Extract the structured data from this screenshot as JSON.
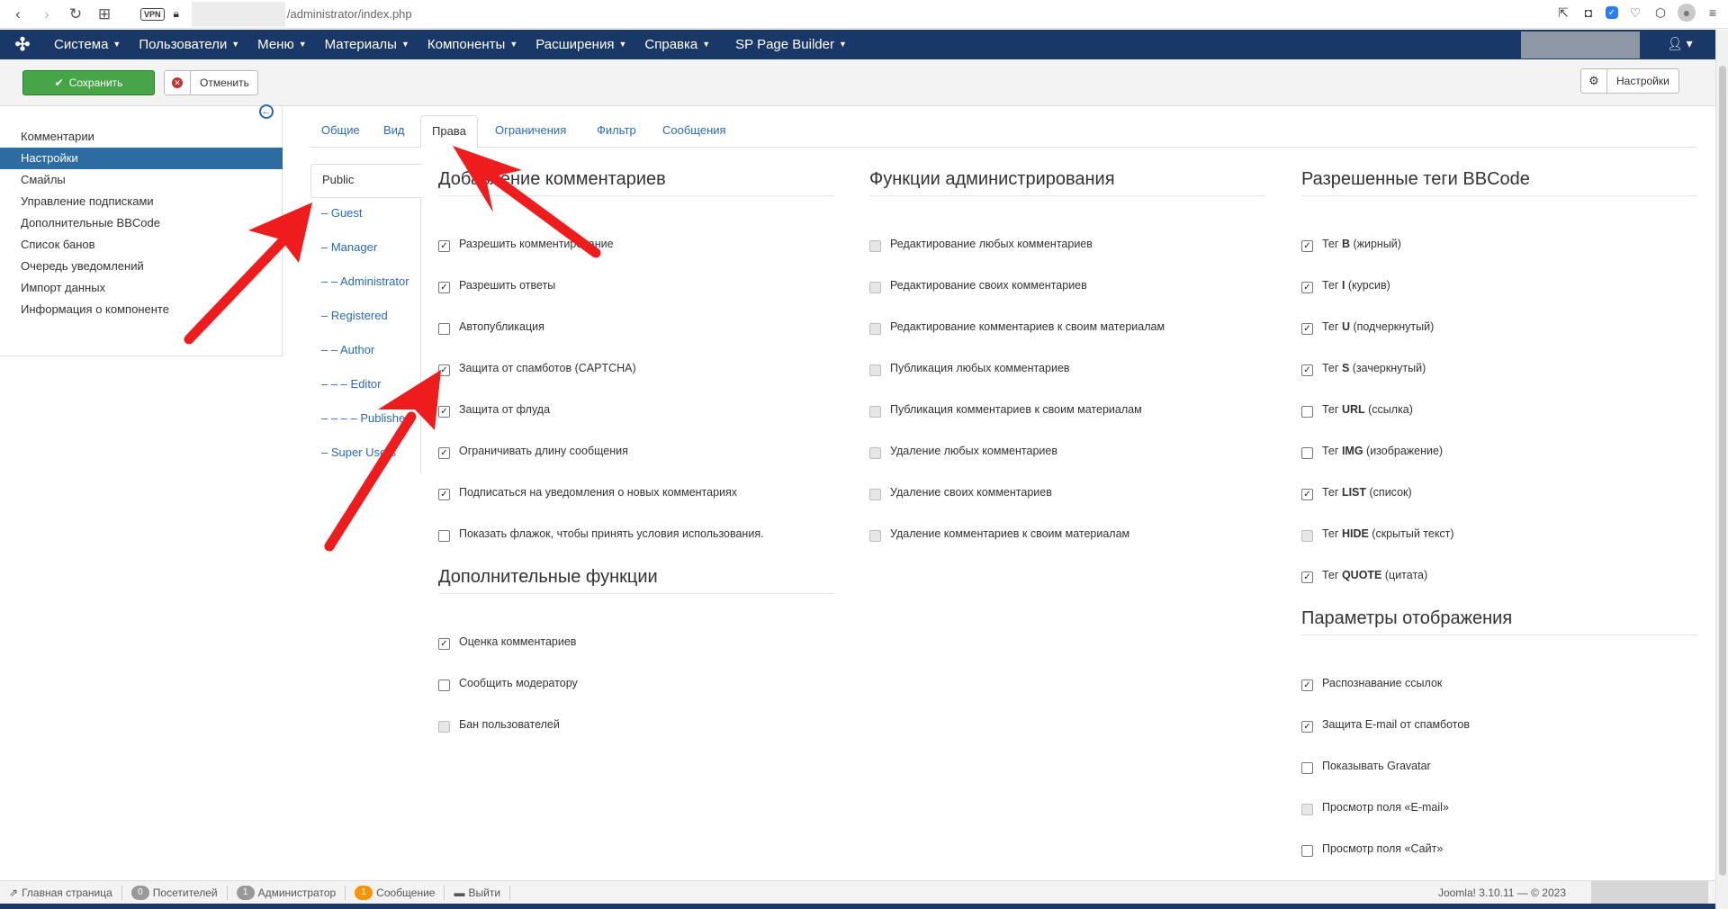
{
  "browser": {
    "vpn": "VPN",
    "url": "/administrator/index.php"
  },
  "topnav": {
    "items": [
      "Система",
      "Пользователи",
      "Меню",
      "Материалы",
      "Компоненты",
      "Расширения",
      "Справка",
      "SP Page Builder"
    ]
  },
  "toolbar": {
    "save": "Сохранить",
    "cancel": "Отменить",
    "options": "Настройки"
  },
  "sidebar": {
    "items": [
      "Комментарии",
      "Настройки",
      "Смайлы",
      "Управление подписками",
      "Дополнительные BBCode",
      "Список банов",
      "Очередь уведомлений",
      "Импорт данных",
      "Информация о компоненте"
    ],
    "active": 1
  },
  "tabs": [
    "Общие",
    "Вид",
    "Права",
    "Ограничения",
    "Фильтр",
    "Сообщения"
  ],
  "active_tab": 2,
  "groups": [
    "Public",
    "– Guest",
    "– Manager",
    "– – Administrator",
    "– Registered",
    "– – Author",
    "– – – Editor",
    "– – – – Publisher",
    "– Super Users"
  ],
  "col1": {
    "title1": "Добавление комментариев",
    "items1": [
      {
        "label": "Разрешить комментирование",
        "state": "checked"
      },
      {
        "label": "Разрешить ответы",
        "state": "checked"
      },
      {
        "label": "Автопубликация",
        "state": "unchecked"
      },
      {
        "label": "Защита от спамботов (CAPTCHA)",
        "state": "checked"
      },
      {
        "label": "Защита от флуда",
        "state": "checked"
      },
      {
        "label": "Ограничивать длину сообщения",
        "state": "checked"
      },
      {
        "label": "Подписаться на уведомления о новых комментариях",
        "state": "checked"
      },
      {
        "label": "Показать флажок, чтобы принять условия использования.",
        "state": "unchecked"
      }
    ],
    "title2": "Дополнительные функции",
    "items2": [
      {
        "label": "Оценка комментариев",
        "state": "checked"
      },
      {
        "label": "Сообщить модератору",
        "state": "unchecked"
      },
      {
        "label": "Бан пользователей",
        "state": "disabled"
      }
    ]
  },
  "col2": {
    "title1": "Функции администрирования",
    "items1": [
      {
        "label": "Редактирование любых комментариев",
        "state": "disabled"
      },
      {
        "label": "Редактирование своих комментариев",
        "state": "disabled"
      },
      {
        "label": "Редактирование комментариев к своим материалам",
        "state": "disabled"
      },
      {
        "label": "Публикация любых комментариев",
        "state": "disabled"
      },
      {
        "label": "Публикация комментариев к своим материалам",
        "state": "disabled"
      },
      {
        "label": "Удаление любых комментариев",
        "state": "disabled"
      },
      {
        "label": "Удаление своих комментариев",
        "state": "disabled"
      },
      {
        "label": "Удаление комментариев к своим материалам",
        "state": "disabled"
      }
    ]
  },
  "col3": {
    "title1": "Разрешенные теги BBCode",
    "items1": [
      {
        "tag": "B",
        "desc": "(жирный)",
        "state": "checked"
      },
      {
        "tag": "I",
        "desc": "(курсив)",
        "state": "checked"
      },
      {
        "tag": "U",
        "desc": "(подчеркнутый)",
        "state": "checked"
      },
      {
        "tag": "S",
        "desc": "(зачеркнутый)",
        "state": "checked"
      },
      {
        "tag": "URL",
        "desc": "(ссылка)",
        "state": "unchecked"
      },
      {
        "tag": "IMG",
        "desc": "(изображение)",
        "state": "unchecked"
      },
      {
        "tag": "LIST",
        "desc": "(список)",
        "state": "checked"
      },
      {
        "tag": "HIDE",
        "desc": "(скрытый текст)",
        "state": "disabled"
      },
      {
        "tag": "QUOTE",
        "desc": "(цитата)",
        "state": "checked"
      }
    ],
    "tag_prefix": "Тег",
    "title2": "Параметры отображения",
    "items2": [
      {
        "label": "Распознавание ссылок",
        "state": "checked"
      },
      {
        "label": "Защита E-mail от спамботов",
        "state": "checked"
      },
      {
        "label": "Показывать Gravatar",
        "state": "unchecked"
      },
      {
        "label": "Просмотр поля «E-mail»",
        "state": "disabled"
      },
      {
        "label": "Просмотр поля «Сайт»",
        "state": "unchecked"
      }
    ]
  },
  "footer": {
    "home": "Главная страница",
    "visitors_count": "0",
    "visitors": "Посетителей",
    "admins_count": "1",
    "admins": "Администратор",
    "messages_count": "1",
    "messages": "Сообщение",
    "logout": "Выйти",
    "version": "Joomla! 3.10.11 — © 2023"
  }
}
